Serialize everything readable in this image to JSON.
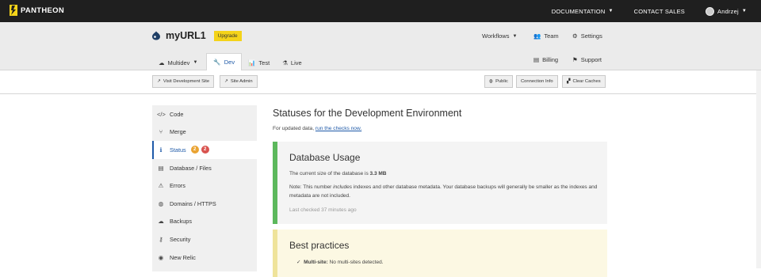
{
  "topbar": {
    "brand": "PANTHEON",
    "nav": [
      {
        "label": "DOCUMENTATION",
        "caret": "⏷"
      },
      {
        "label": "CONTACT SALES"
      },
      {
        "label": "Andrzej",
        "caret": "⏷"
      }
    ]
  },
  "site": {
    "name": "myURL1",
    "upgrade_label": "Upgrade",
    "workflows_label": "Workflows",
    "team_label": "Team",
    "settings_label": "Settings",
    "billing_label": "Billing",
    "support_label": "Support",
    "env_tabs": [
      {
        "label": "Multidev",
        "icon": "cloud-icon"
      },
      {
        "label": "Dev",
        "icon": "wrench-icon",
        "active": true
      },
      {
        "label": "Test",
        "icon": "chart-icon"
      },
      {
        "label": "Live",
        "icon": "flask-icon"
      }
    ]
  },
  "actionbar": {
    "visit_site": "Visit Development Site",
    "site_admin": "Site Admin",
    "public": "Public",
    "connection_info": "Connection Info",
    "clear_caches": "Clear Caches"
  },
  "sidebar": {
    "items": [
      {
        "label": "Code",
        "icon": "code-icon"
      },
      {
        "label": "Merge",
        "icon": "merge-icon"
      },
      {
        "label": "Status",
        "icon": "info-icon",
        "active": true,
        "badge_warn": "2",
        "badge_err": "2"
      },
      {
        "label": "Database / Files",
        "icon": "database-icon"
      },
      {
        "label": "Errors",
        "icon": "warning-icon"
      },
      {
        "label": "Domains / HTTPS",
        "icon": "globe-icon"
      },
      {
        "label": "Backups",
        "icon": "cloud-upload-icon"
      },
      {
        "label": "Security",
        "icon": "key-icon"
      },
      {
        "label": "New Relic",
        "icon": "eye-icon"
      }
    ]
  },
  "main": {
    "title": "Statuses for the Development Environment",
    "subnote_prefix": "For updated data,",
    "subnote_link": "run the checks now.",
    "db_panel": {
      "title": "Database Usage",
      "size_prefix": "The current size of the database is ",
      "size_value": "3.3 MB",
      "note_a": "Note: This number ",
      "note_em": "includes",
      "note_b": " indexes and other database metadata. Your database backups will generally be smaller as the indexes and metadata are not included.",
      "last_checked": "Last checked 37 minutes ago"
    },
    "bp_panel": {
      "title": "Best practices",
      "item_label": "Multi-site:",
      "item_text": " No multi-sites detected."
    }
  },
  "colors": {
    "topbar": "#1f1f1f",
    "accent": "#1f5aa8",
    "upgrade": "#f4d319",
    "success": "#5cb85c",
    "warning": "#eaa332",
    "danger": "#d9534f"
  }
}
